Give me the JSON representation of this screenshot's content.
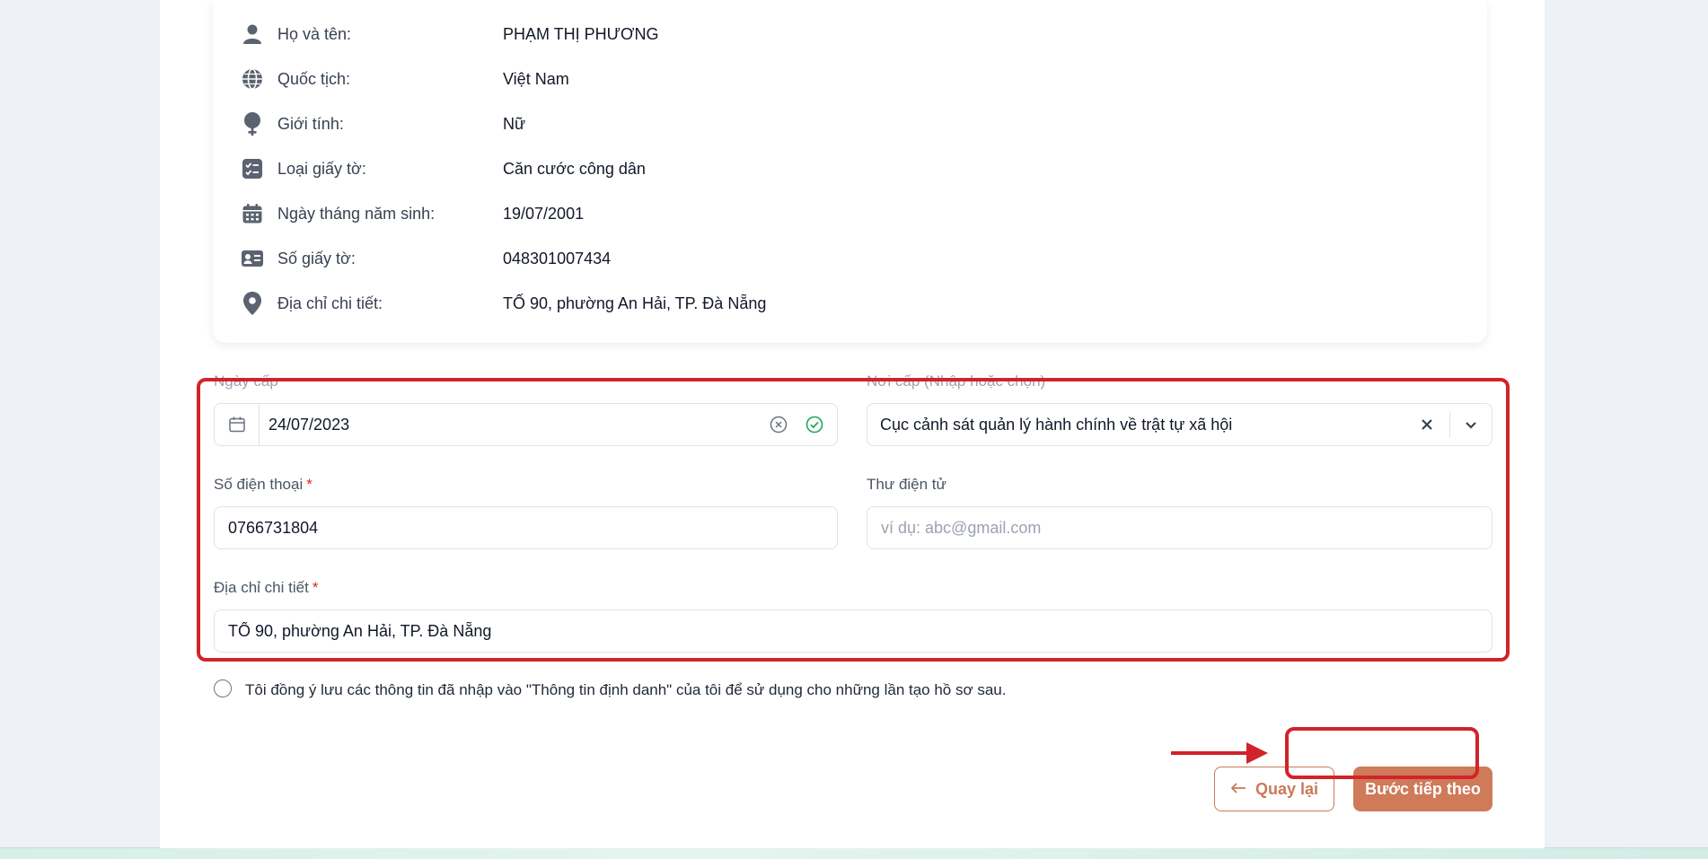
{
  "personal_info": [
    {
      "icon": "user-icon",
      "label": "Họ và tên:",
      "value": "PHẠM THỊ PHƯƠNG"
    },
    {
      "icon": "globe-icon",
      "label": "Quốc tịch:",
      "value": "Việt Nam"
    },
    {
      "icon": "gender-icon",
      "label": "Giới tính:",
      "value": "Nữ"
    },
    {
      "icon": "checklist-icon",
      "label": "Loại giấy tờ:",
      "value": "Căn cước công dân"
    },
    {
      "icon": "calendar-icon",
      "label": "Ngày tháng năm sinh:",
      "value": "19/07/2001"
    },
    {
      "icon": "id-card-icon",
      "label": "Số giấy tờ:",
      "value": "048301007434"
    },
    {
      "icon": "location-pin-icon",
      "label": "Địa chỉ chi tiết:",
      "value": "TỐ 90, phường An Hải, TP. Đà Nẵng"
    }
  ],
  "form": {
    "issue_date": {
      "label": "Ngày cấp",
      "value": "24/07/2023"
    },
    "issue_place": {
      "label": "Nơi cấp (Nhập hoặc chọn)",
      "value": "Cục cảnh sát quản lý hành chính về trật tự xã hội"
    },
    "phone": {
      "label": "Số điện thoại",
      "required_mark": "*",
      "value": "0766731804"
    },
    "email": {
      "label": "Thư điện tử",
      "placeholder": "ví dụ: abc@gmail.com",
      "value": ""
    },
    "address": {
      "label": "Địa chỉ chi tiết",
      "required_mark": "*",
      "value": "TỐ 90, phường An Hải, TP. Đà Nẵng"
    }
  },
  "consent": {
    "text": "Tôi đồng ý lưu các thông tin đã nhập vào \"Thông tin định danh\" của tôi để sử dụng cho những lần tạo hồ sơ sau.",
    "checked": false
  },
  "buttons": {
    "back": "Quay lại",
    "next": "Bước tiếp theo"
  },
  "colors": {
    "accent": "#cf7a58",
    "annotation": "#d2232a",
    "success": "#22a45d"
  }
}
